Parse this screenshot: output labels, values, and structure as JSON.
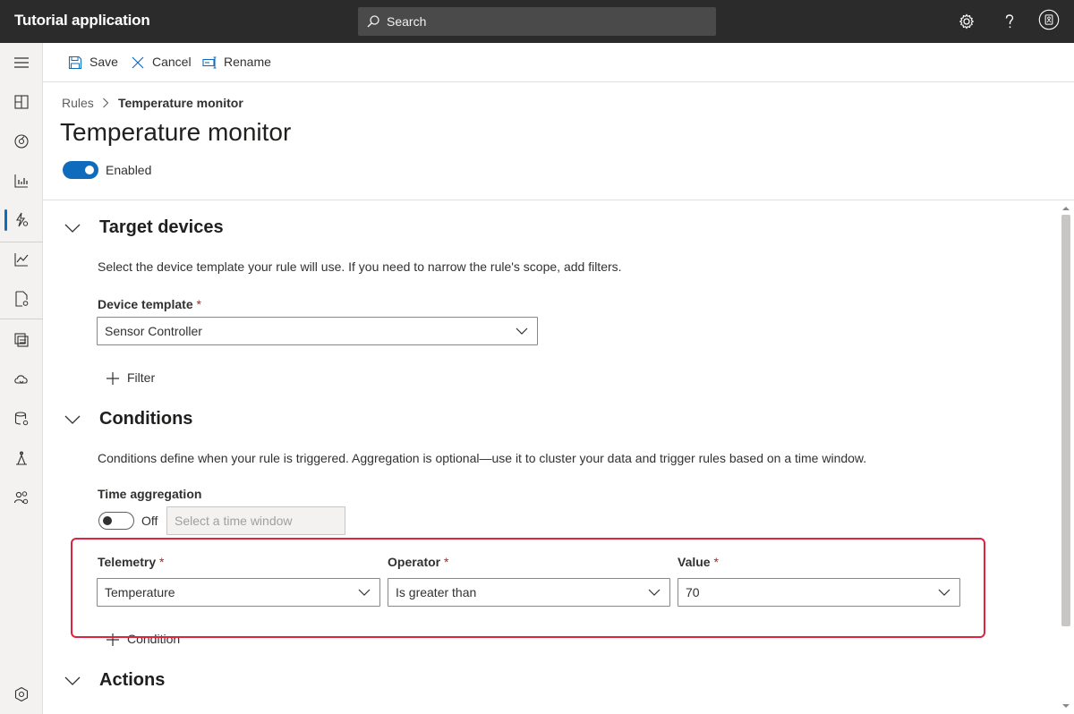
{
  "topbar": {
    "app_title": "Tutorial application",
    "search_placeholder": "Search",
    "icons": [
      "settings-icon",
      "help-icon",
      "account-icon"
    ]
  },
  "leftnav": {
    "items": [
      "menu-icon",
      "dashboard-icon",
      "devices-icon",
      "analytics-icon",
      "rules-icon",
      "chart-icon",
      "jobs-icon",
      "device-templates-icon",
      "data-export-icon",
      "data-icon",
      "administration-icon",
      "users-icon",
      "app-settings-icon"
    ]
  },
  "commandbar": {
    "save": "Save",
    "cancel": "Cancel",
    "rename": "Rename"
  },
  "breadcrumb": {
    "parent": "Rules",
    "current": "Temperature monitor"
  },
  "page": {
    "title": "Temperature monitor",
    "enabled_label": "Enabled",
    "enabled": true
  },
  "target_devices": {
    "title": "Target devices",
    "description": "Select the device template your rule will use. If you need to narrow the rule's scope, add filters.",
    "device_template_label": "Device template",
    "required_mark": "*",
    "device_template_value": "Sensor Controller",
    "filter_label": "Filter"
  },
  "conditions": {
    "title": "Conditions",
    "description": "Conditions define when your rule is triggered. Aggregation is optional—use it to cluster your data and trigger rules based on a time window.",
    "time_aggregation_label": "Time aggregation",
    "time_aggregation_state": "Off",
    "time_window_placeholder": "Select a time window",
    "telemetry_label": "Telemetry",
    "telemetry_value": "Temperature",
    "operator_label": "Operator",
    "operator_value": "Is greater than",
    "value_label": "Value",
    "value_value": "70",
    "add_condition_label": "Condition"
  },
  "actions": {
    "title": "Actions"
  },
  "colors": {
    "accent": "#0f6cbd",
    "topbar": "#2b2b2b",
    "highlight": "#e0233e",
    "required": "#a4262c"
  }
}
